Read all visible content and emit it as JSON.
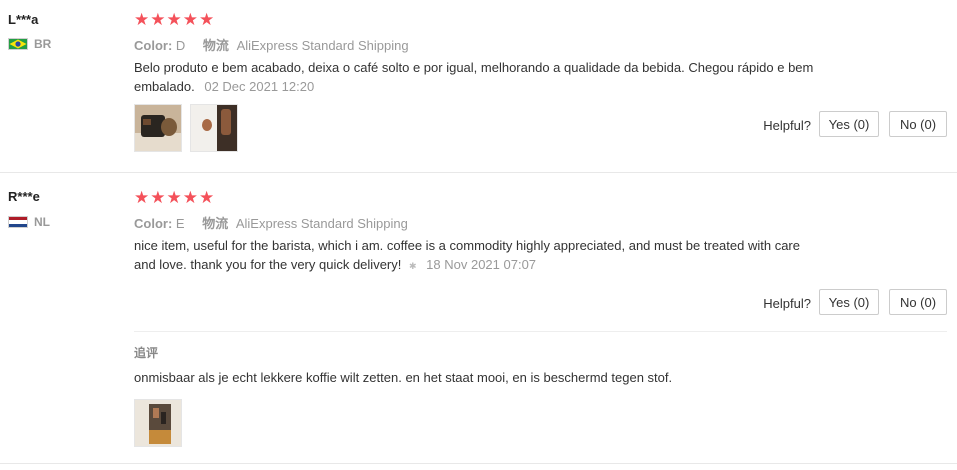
{
  "reviews": [
    {
      "user": "L***a",
      "country": "BR",
      "rating": 5,
      "color_label": "Color:",
      "color_value": "D",
      "shipping_label": "物流",
      "shipping_value": "AliExpress Standard Shipping",
      "text_line1": "Belo produto e bem acabado, deixa o café solto e por igual, melhorando a qualidade da bebida. Chegou rápido e bem",
      "text_line2": "embalado.",
      "date": "02 Dec 2021 12:20",
      "helpful_label": "Helpful?",
      "yes_label": "Yes (0)",
      "no_label": "No (0)"
    },
    {
      "user": "R***e",
      "country": "NL",
      "rating": 5,
      "color_label": "Color:",
      "color_value": "E",
      "shipping_label": "物流",
      "shipping_value": "AliExpress Standard Shipping",
      "text_line1": "nice item, useful for the barista, which i am. coffee is a commodity highly appreciated, and must be treated with care",
      "text_line2": "and love. thank you for the very quick delivery!",
      "date": "18 Nov 2021 07:07",
      "helpful_label": "Helpful?",
      "yes_label": "Yes (0)",
      "no_label": "No (0)",
      "followup_label": "追评",
      "followup_text": "onmisbaar als je echt lekkere koffie wilt zetten. en het staat mooi, en is beschermd tegen stof."
    }
  ],
  "colors": {
    "star": "#f4515a",
    "muted": "#999999",
    "text": "#333333"
  }
}
